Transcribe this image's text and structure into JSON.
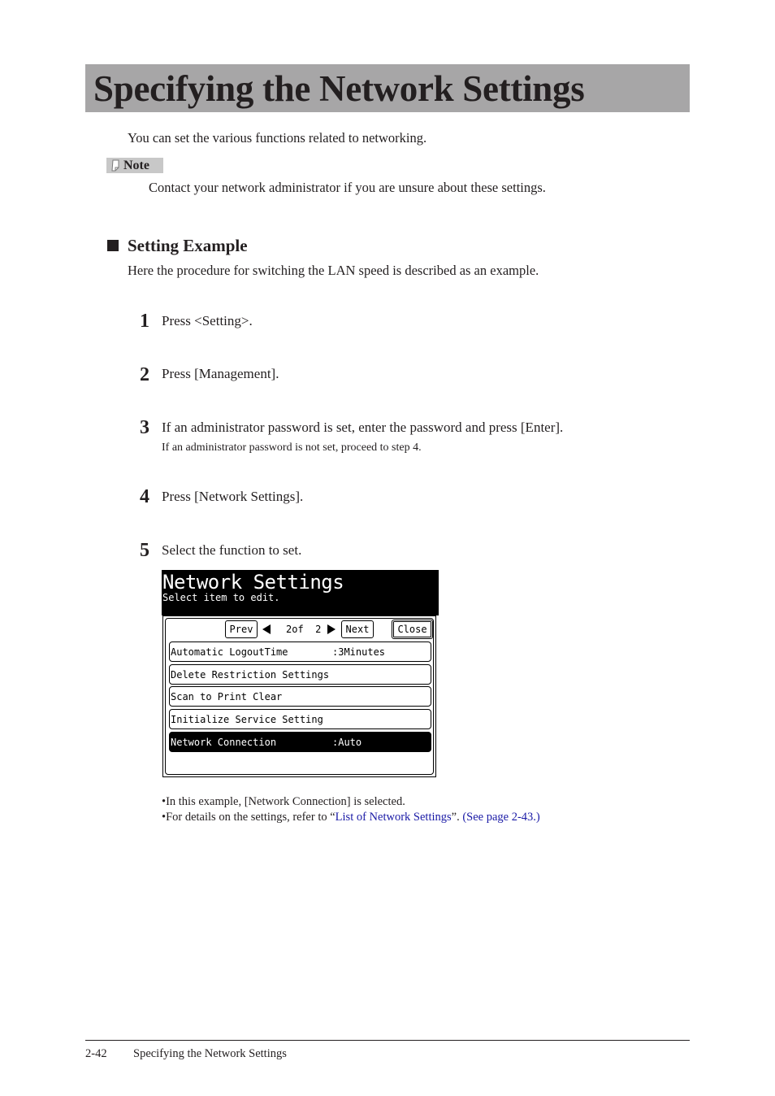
{
  "page": {
    "title": "Specifying the Network Settings",
    "intro": "You can set the various functions related to networking.",
    "note": {
      "icon": "pencil-note-icon",
      "label": "Note",
      "text": "Contact your network administrator if you are unsure about these settings."
    },
    "section": {
      "icon": "black-square-bullet",
      "title": "Setting Example",
      "description": "Here the procedure for switching the LAN speed is described as an example."
    },
    "steps": [
      {
        "number": "1",
        "text": "Press <Setting>."
      },
      {
        "number": "2",
        "text": "Press [Management]."
      },
      {
        "number": "3",
        "text": "If an administrator password is set, enter the password and press [Enter].",
        "subtext": "If an administrator password is not set, proceed to step 4."
      },
      {
        "number": "4",
        "text": "Press [Network Settings]."
      },
      {
        "number": "5",
        "text": "Select the function to set."
      }
    ],
    "screen": {
      "title": "Network Settings",
      "subtitle": "Select item to edit.",
      "prev_label": "Prev",
      "next_label": "Next",
      "close_label": "Close",
      "page_current": "2",
      "page_of": "of",
      "page_total": "2",
      "items": [
        {
          "label": "Automatic LogoutTime",
          "value": ":3Minutes",
          "selected": false
        },
        {
          "label": "Delete Restriction Settings",
          "value": "",
          "selected": false
        },
        {
          "label": "Scan to Print Clear",
          "value": "",
          "selected": false
        },
        {
          "label": "Initialize Service Setting",
          "value": "",
          "selected": false
        },
        {
          "label": "Network Connection",
          "value": ":Auto",
          "selected": true
        }
      ]
    },
    "bullets": {
      "first": "In this example, [Network Connection] is selected.",
      "second_prefix": "For details on the settings, refer to “",
      "second_link": "List of Network Settings",
      "second_mid": "”. ",
      "second_ref": "(See page 2-43.)"
    },
    "footer": {
      "page_number": "2-42",
      "chapter_title": "Specifying the Network Settings"
    },
    "colors": {
      "title_bar": "#a7a6a7",
      "link": "#1a1aa6",
      "note_badge": "#c8c8c8"
    }
  }
}
